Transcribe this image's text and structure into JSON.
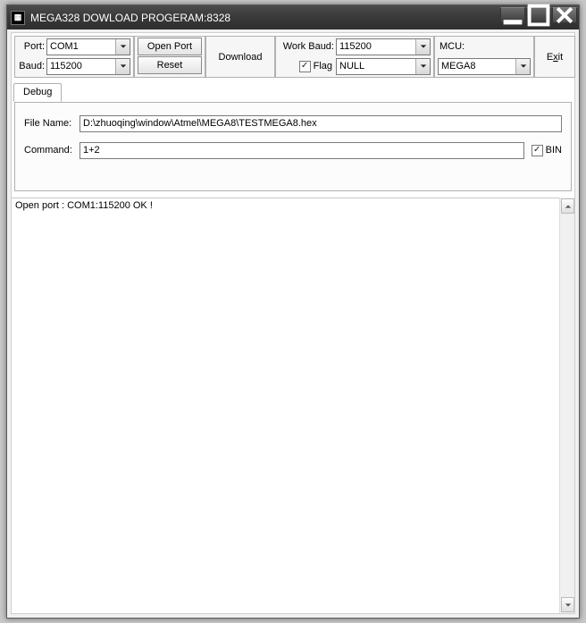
{
  "title": "MEGA328 DOWLOAD PROGERAM:8328",
  "toolbar": {
    "port_label": "Port:",
    "port_value": "COM1",
    "baud_label": "Baud:",
    "baud_value": "115200",
    "open_port": "Open Port",
    "reset": "Reset",
    "download": "Download",
    "workbaud_label": "Work Baud:",
    "workbaud_value": "115200",
    "flag_label": "Flag",
    "flag_checked": true,
    "flagcombo_value": "NULL",
    "mcu_label": "MCU:",
    "mcu_value": "MEGA8",
    "exit_prefix": "E",
    "exit_underline": "x",
    "exit_suffix": "it"
  },
  "tab": {
    "label": "Debug",
    "filename_label": "File Name:",
    "filename_value": "D:\\zhuoqing\\window\\Atmel\\MEGA8\\TESTMEGA8.hex",
    "command_label": "Command:",
    "command_value": "1+2",
    "bin_label": "BIN",
    "bin_checked": true
  },
  "output": "Open port : COM1:115200 OK !"
}
